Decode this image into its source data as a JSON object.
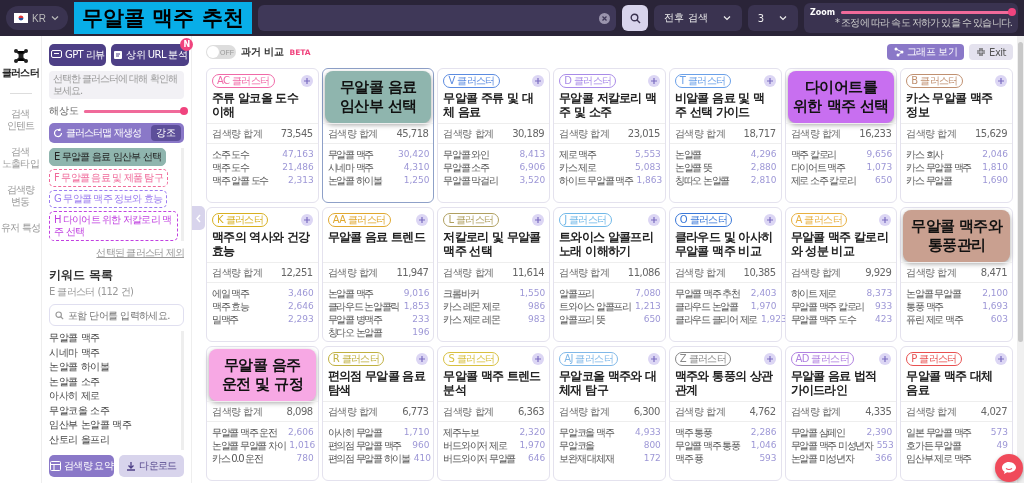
{
  "top_bar": {
    "language": "KR",
    "banner": "무알콜 맥주 추천",
    "period_select": "전후 검색",
    "depth_select": "3",
    "zoom": {
      "label": "Zoom",
      "level": 1,
      "note": "* 조정에 따라 속도 저하가 있을 수 있습니다."
    }
  },
  "rail": [
    {
      "label": "클러스터",
      "kind": "cluster",
      "selected": true
    },
    {
      "label": "검색 인텐트",
      "kind": "text",
      "selected": false
    },
    {
      "label": "검색 노출타입",
      "kind": "text",
      "selected": false
    },
    {
      "label": "검색량 변동",
      "kind": "text",
      "selected": false
    },
    {
      "label": "유저 특성",
      "kind": "text",
      "selected": false
    }
  ],
  "sidebar": {
    "buttons": [
      {
        "label": "GPT 리뷰",
        "kind": "chat"
      },
      {
        "label": "상위 URL 분석",
        "kind": "document",
        "badge": "N"
      }
    ],
    "info": "선택한 클러스터에 대해 확인해보세요.",
    "resolution": {
      "label": "해상도",
      "level": 1
    },
    "regenerate": {
      "label": "클러스터맵 재생성",
      "emphasis": "강조"
    },
    "clusters": [
      {
        "label": "E 무알콜 음료 임산부 선택",
        "color": "#8fb5ae",
        "selected": true
      },
      {
        "label": "F 무알콜 음료 및 제품 탐구",
        "color": "#f06a9a",
        "selected": false
      },
      {
        "label": "G 무알콜 맥주 정보와 효능",
        "color": "#9b7cf0",
        "selected": false
      },
      {
        "label": "H 다이어트 위한 저칼로리 맥주 선택",
        "color": "#c040e0",
        "selected": false
      }
    ],
    "exclude_link": "선택된 클러스터 제외",
    "keyword_list": {
      "title": "키워드 목록",
      "subtitle": "E 클러스터 (112 건)",
      "placeholder": "포함 단어를 입력하세요.",
      "items": [
        "무알콜 맥주",
        "시네마 맥주",
        "논알콜 하이볼",
        "논알콜 소주",
        "아사히 제로",
        "무알코올 소주",
        "임산부 논알콜 맥주",
        "산토리 올프리"
      ]
    },
    "actions": [
      {
        "label": "검색량 요약",
        "kind": "summary"
      },
      {
        "label": "다운로드",
        "kind": "download"
      }
    ]
  },
  "compare": {
    "on": false,
    "toggle_text": "OFF",
    "label": "과거 비교",
    "tag": "BETA"
  },
  "toolbar": [
    {
      "label": "그래프 보기",
      "kind": "graph"
    },
    {
      "label": "Exit",
      "kind": "exit"
    }
  ],
  "cards": [
    {
      "badge": "AC 클러스터",
      "color": "#f06aa8",
      "title": "주류 알코올 도수 이해",
      "selected": false,
      "total_label": "검색량 합계",
      "total": "73,545",
      "keywords": [
        {
          "name": "소주 도수",
          "value": "47,163"
        },
        {
          "name": "맥주 도수",
          "value": "21,486"
        },
        {
          "name": "맥주 알콜 도수",
          "value": "2,313"
        }
      ]
    },
    {
      "callout": {
        "text": "무알콜 음료 임산부 선택",
        "color": "#8fb5ae"
      },
      "selected": true,
      "total_label": "검색량 합계",
      "total": "45,718",
      "keywords": [
        {
          "name": "무알콜 맥주",
          "value": "30,420"
        },
        {
          "name": "시네마 맥주",
          "value": "4,310"
        },
        {
          "name": "논알콜 하이볼",
          "value": "1,250"
        }
      ]
    },
    {
      "badge": "V 클러스터",
      "color": "#5b8be0",
      "title": "무알콜 주류 및 대체 음료",
      "selected": false,
      "total_label": "검색량 합계",
      "total": "30,189",
      "keywords": [
        {
          "name": "무알콜 와인",
          "value": "8,413"
        },
        {
          "name": "무알콜 소주",
          "value": "6,906"
        },
        {
          "name": "무알콜 막걸리",
          "value": "3,520"
        }
      ]
    },
    {
      "badge": "D 클러스터",
      "color": "#a98be8",
      "title": "무알콜 저칼로리 맥주 및 소주",
      "selected": false,
      "total_label": "검색량 합계",
      "total": "23,015",
      "keywords": [
        {
          "name": "제로 맥주",
          "value": "5,553"
        },
        {
          "name": "카스 제로",
          "value": "5,083"
        },
        {
          "name": "하이트 무알콜 맥주",
          "value": "1,863"
        }
      ]
    },
    {
      "badge": "T 클러스터",
      "color": "#6aa0e8",
      "title": "비알콜 음료 및 맥주 선택 가이드",
      "selected": false,
      "total_label": "검색량 합계",
      "total": "18,717",
      "keywords": [
        {
          "name": "논알콜",
          "value": "4,296"
        },
        {
          "name": "논알콜 뜻",
          "value": "2,880"
        },
        {
          "name": "칭따오 논알콜",
          "value": "2,810"
        }
      ]
    },
    {
      "callout": {
        "text": "다이어트를 위한 맥주 선택",
        "color": "#c86ff0"
      },
      "selected": false,
      "total_label": "검색량 합계",
      "total": "16,233",
      "keywords": [
        {
          "name": "맥주 칼로리",
          "value": "9,656"
        },
        {
          "name": "다이어트 맥주",
          "value": "1,073"
        },
        {
          "name": "제로 소주 칼로리",
          "value": "650"
        }
      ]
    },
    {
      "badge": "B 클러스터",
      "color": "#c09070",
      "title": "카스 무알콜 맥주 정보",
      "selected": false,
      "total_label": "검색량 합계",
      "total": "15,629",
      "keywords": [
        {
          "name": "카스 회사",
          "value": "2,046"
        },
        {
          "name": "카스 무알콜 맥주",
          "value": "1,810"
        },
        {
          "name": "카스 무알콜",
          "value": "1,690"
        }
      ]
    },
    {
      "badge": "K 클러스터",
      "color": "#d8b020",
      "title": "맥주의 역사와 건강 효능",
      "selected": false,
      "total_label": "검색량 합계",
      "total": "12,251",
      "keywords": [
        {
          "name": "에일 맥주",
          "value": "3,460"
        },
        {
          "name": "맥주 효능",
          "value": "2,646"
        },
        {
          "name": "밀맥주",
          "value": "2,293"
        }
      ]
    },
    {
      "badge": "AA 클러스터",
      "color": "#e0a830",
      "title": "무알콜 음료 트렌드",
      "selected": false,
      "total_label": "검색량 합계",
      "total": "11,947",
      "keywords": [
        {
          "name": "논알콜 맥주",
          "value": "9,016"
        },
        {
          "name": "클라우드 논알콜릭",
          "value": "1,853"
        },
        {
          "name": "무알콜 병맥주",
          "value": "233"
        },
        {
          "name": "칭다오 논알콜",
          "value": "196"
        }
      ]
    },
    {
      "badge": "L 클러스터",
      "color": "#b0a060",
      "title": "저칼로리 및 무알콜 맥주 선택",
      "selected": false,
      "total_label": "검색량 합계",
      "total": "11,614",
      "keywords": [
        {
          "name": "크롬바커",
          "value": "1,550"
        },
        {
          "name": "카스 레몬 제로",
          "value": "986"
        },
        {
          "name": "카스 제로 레몬",
          "value": "983"
        }
      ]
    },
    {
      "badge": "J 클러스터",
      "color": "#70b8e8",
      "title": "트와이스 알콜프리 노래 이해하기",
      "selected": false,
      "total_label": "검색량 합계",
      "total": "11,086",
      "keywords": [
        {
          "name": "알콜프리",
          "value": "7,080"
        },
        {
          "name": "트와이스 알콜프리",
          "value": "1,213"
        },
        {
          "name": "알콜프리 뜻",
          "value": "650"
        }
      ]
    },
    {
      "badge": "O 클러스터",
      "color": "#3a78d8",
      "title": "클라우드 및 아사히 무알콜 맥주 비교",
      "selected": false,
      "total_label": "검색량 합계",
      "total": "10,385",
      "keywords": [
        {
          "name": "무알콜 맥주 추천",
          "value": "2,403"
        },
        {
          "name": "클라우드 논알콜",
          "value": "1,970"
        },
        {
          "name": "클라우드 클리어 제로",
          "value": "1,923"
        }
      ]
    },
    {
      "badge": "A 클러스터",
      "color": "#e8b040",
      "title": "무알콜 맥주 칼로리와 성분 비교",
      "selected": false,
      "total_label": "검색량 합계",
      "total": "9,929",
      "keywords": [
        {
          "name": "하이트 제로",
          "value": "8,373"
        },
        {
          "name": "무알콜 맥주 칼로리",
          "value": "933"
        },
        {
          "name": "무알콜 맥주 도수",
          "value": "423"
        }
      ]
    },
    {
      "callout": {
        "text": "무알콜 맥주와 통풍관리",
        "color": "#c9a090"
      },
      "selected": false,
      "total_label": "검색량 합계",
      "total": "8,471",
      "keywords": [
        {
          "name": "논알콜 무알콜",
          "value": "2,100"
        },
        {
          "name": "통풍 맥주",
          "value": "1,693"
        },
        {
          "name": "퓨린 제로 맥주",
          "value": "603"
        }
      ]
    },
    {
      "callout": {
        "text": "무알콜 음주 운전 및 규정",
        "color": "#f7a8e4"
      },
      "selected": false,
      "total_label": "검색량 합계",
      "total": "8,098",
      "keywords": [
        {
          "name": "무알콜 맥주 운전",
          "value": "2,606"
        },
        {
          "name": "논알콜 무알콜 차이",
          "value": "1,016"
        },
        {
          "name": "카스 0.0 운전",
          "value": "780"
        }
      ]
    },
    {
      "badge": "R 클러스터",
      "color": "#c0b040",
      "title": "편의점 무알콜 음료 탐색",
      "selected": false,
      "total_label": "검색량 합계",
      "total": "6,773",
      "keywords": [
        {
          "name": "아사히 무알콜",
          "value": "1,710"
        },
        {
          "name": "편의점 무알콜 맥주",
          "value": "960"
        },
        {
          "name": "편의점 무알콜 하이볼",
          "value": "410"
        }
      ]
    },
    {
      "badge": "S 클러스터",
      "color": "#d8c040",
      "title": "무알콜 맥주 트렌드 분석",
      "selected": false,
      "total_label": "검색량 합계",
      "total": "6,363",
      "keywords": [
        {
          "name": "제주누보",
          "value": "2,320"
        },
        {
          "name": "버드와이저 제로",
          "value": "1,970"
        },
        {
          "name": "버드와이저 무알콜",
          "value": "646"
        }
      ]
    },
    {
      "badge": "AJ 클러스터",
      "color": "#80b8e8",
      "title": "무알코올 맥주와 대체재 탐구",
      "selected": false,
      "total_label": "검색량 합계",
      "total": "6,300",
      "keywords": [
        {
          "name": "무알코올 맥주",
          "value": "4,933"
        },
        {
          "name": "무알코올",
          "value": "800"
        },
        {
          "name": "보완재 대체재",
          "value": "172"
        }
      ]
    },
    {
      "badge": "Z 클러스터",
      "color": "#888888",
      "title": "맥주와 통풍의 상관관계",
      "selected": false,
      "total_label": "검색량 합계",
      "total": "4,762",
      "keywords": [
        {
          "name": "맥주 통풍",
          "value": "2,286"
        },
        {
          "name": "무알콜 맥주 통풍",
          "value": "1,046"
        },
        {
          "name": "맥주 퓽",
          "value": "593"
        }
      ]
    },
    {
      "badge": "AD 클러스터",
      "color": "#b080e0",
      "title": "무알콜 음료 법적 가이드라인",
      "selected": false,
      "total_label": "검색량 합계",
      "total": "4,335",
      "keywords": [
        {
          "name": "무알콜 삼페인",
          "value": "2,390"
        },
        {
          "name": "무알콜 맥주 미성년자",
          "value": "553"
        },
        {
          "name": "논알콜 미성년자",
          "value": "366"
        }
      ]
    },
    {
      "badge": "P 클러스터",
      "color": "#e85050",
      "title": "무알콜 맥주 대체 음료",
      "selected": false,
      "total_label": "검색량 합계",
      "total": "4,027",
      "keywords": [
        {
          "name": "일본 무알콜 맥주",
          "value": "573"
        },
        {
          "name": "호가든 무알콜",
          "value": "49"
        },
        {
          "name": "임산부 제로 맥주"
        }
      ]
    }
  ]
}
